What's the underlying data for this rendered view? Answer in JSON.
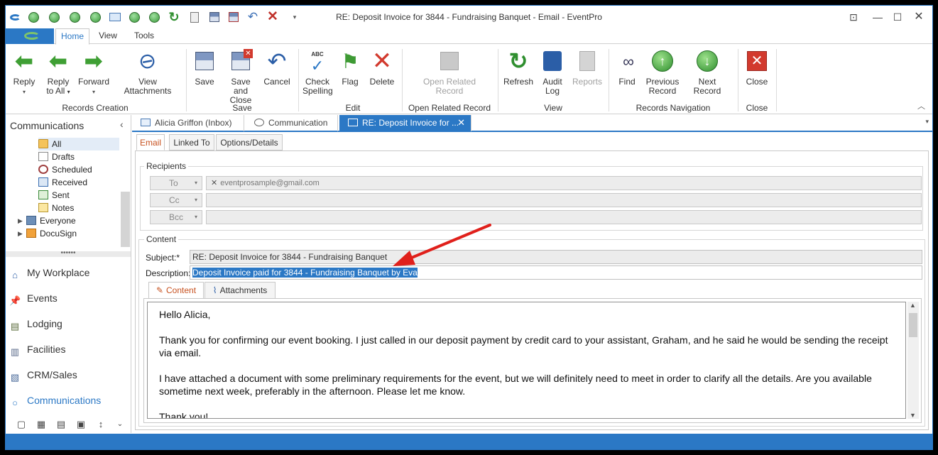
{
  "window": {
    "title": "RE: Deposit Invoice for 3844 - Fundraising Banquet - Email - EventPro"
  },
  "menu_tabs": [
    "Home",
    "View",
    "Tools"
  ],
  "ribbon": {
    "reply": "Reply",
    "reply_all_1": "Reply",
    "reply_all_2": "to All",
    "forward": "Forward",
    "view_attachments": "View Attachments",
    "save": "Save",
    "save_close_1": "Save and",
    "save_close_2": "Close",
    "cancel": "Cancel",
    "check_spelling_1": "Check",
    "check_spelling_2": "Spelling",
    "flag": "Flag",
    "delete": "Delete",
    "open_related_1": "Open Related",
    "open_related_2": "Record",
    "refresh": "Refresh",
    "audit_log_1": "Audit",
    "audit_log_2": "Log",
    "reports": "Reports",
    "find": "Find",
    "previous_record_1": "Previous",
    "previous_record_2": "Record",
    "next_record": "Next Record",
    "close": "Close",
    "groups": {
      "records_creation": "Records Creation",
      "save": "Save",
      "edit": "Edit",
      "open_related": "Open Related Record",
      "view": "View",
      "records_navigation": "Records Navigation",
      "close": "Close"
    },
    "spell_abc": "ABC"
  },
  "leftnav": {
    "header": "Communications",
    "tree": [
      "All",
      "Drafts",
      "Scheduled",
      "Received",
      "Sent",
      "Notes",
      "Everyone",
      "DocuSign"
    ],
    "splitter": "••••••",
    "nav": [
      "My Workplace",
      "Events",
      "Lodging",
      "Facilities",
      "CRM/Sales",
      "Communications"
    ]
  },
  "doc_tabs": [
    "Alicia Griffon (Inbox)",
    "Communication",
    "RE: Deposit Invoice for ..."
  ],
  "form_tabs": [
    "Email",
    "Linked To",
    "Options/Details"
  ],
  "recipients": {
    "group_label": "Recipients",
    "to_label": "To",
    "cc_label": "Cc",
    "bcc_label": "Bcc",
    "to_value": "eventprosample@gmail.com",
    "remove": "✕"
  },
  "content_group": {
    "group_label": "Content",
    "subject_label": "Subject:*",
    "subject_value": "RE: Deposit Invoice for 3844 - Fundraising Banquet",
    "description_label": "Description:",
    "description_value": "Deposit Invoice paid for 3844 - Fundraising Banquet by Eva"
  },
  "content_tabs": [
    "Content",
    "Attachments"
  ],
  "email_body": [
    "Hello Alicia,",
    "Thank you for confirming our event booking.  I just called in our deposit payment by credit card to your assistant, Graham, and he said he would be sending the receipt via email.",
    "I have attached a document with some preliminary requirements for the event, but we will definitely need to meet in order to clarify all the details.  Are you available sometime next week, preferably in the afternoon.  Please let me know.",
    "Thank you!"
  ],
  "colors": {
    "accent": "#2b78c5",
    "annotation_arrow": "#e0201b",
    "active_tab_text": "#c7511f"
  }
}
